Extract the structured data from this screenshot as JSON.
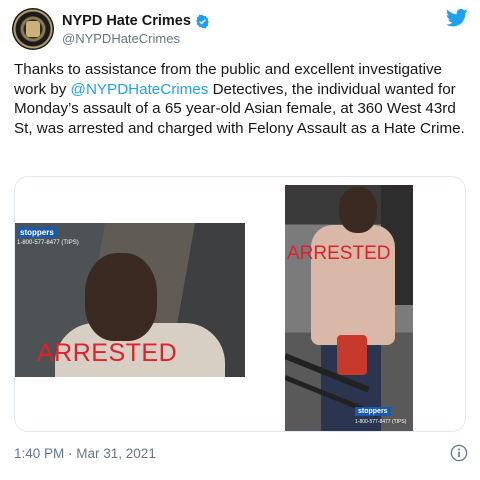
{
  "account": {
    "display_name": "NYPD Hate Crimes",
    "handle": "@NYPDHateCrimes",
    "verified_icon": "verified-badge-icon",
    "brand_icon": "twitter-bird-icon",
    "brand_color": "#1da1f2"
  },
  "tweet": {
    "text_part1": "Thanks to assistance from the public and excellent investigative work by ",
    "mention": "@NYPDHateCrimes",
    "text_part2": " Detectives, the individual wanted for Monday’s assault of a 65 year-old Asian female, at 360 West 43rd St, was arrested and charged with Felony Assault as a Hate Crime."
  },
  "media": {
    "left_photo": {
      "logo_text": "stoppers",
      "phone_text": "1-800-577-8477 (TIPS)",
      "overlay": "ARRESTED"
    },
    "right_photo": {
      "overlay": "ARRESTED",
      "logo_text": "stoppers",
      "phone_text": "1-800-577-8477 (TIPS)"
    }
  },
  "footer": {
    "timestamp": "1:40 PM · Mar 31, 2021",
    "info_icon": "info-icon"
  }
}
